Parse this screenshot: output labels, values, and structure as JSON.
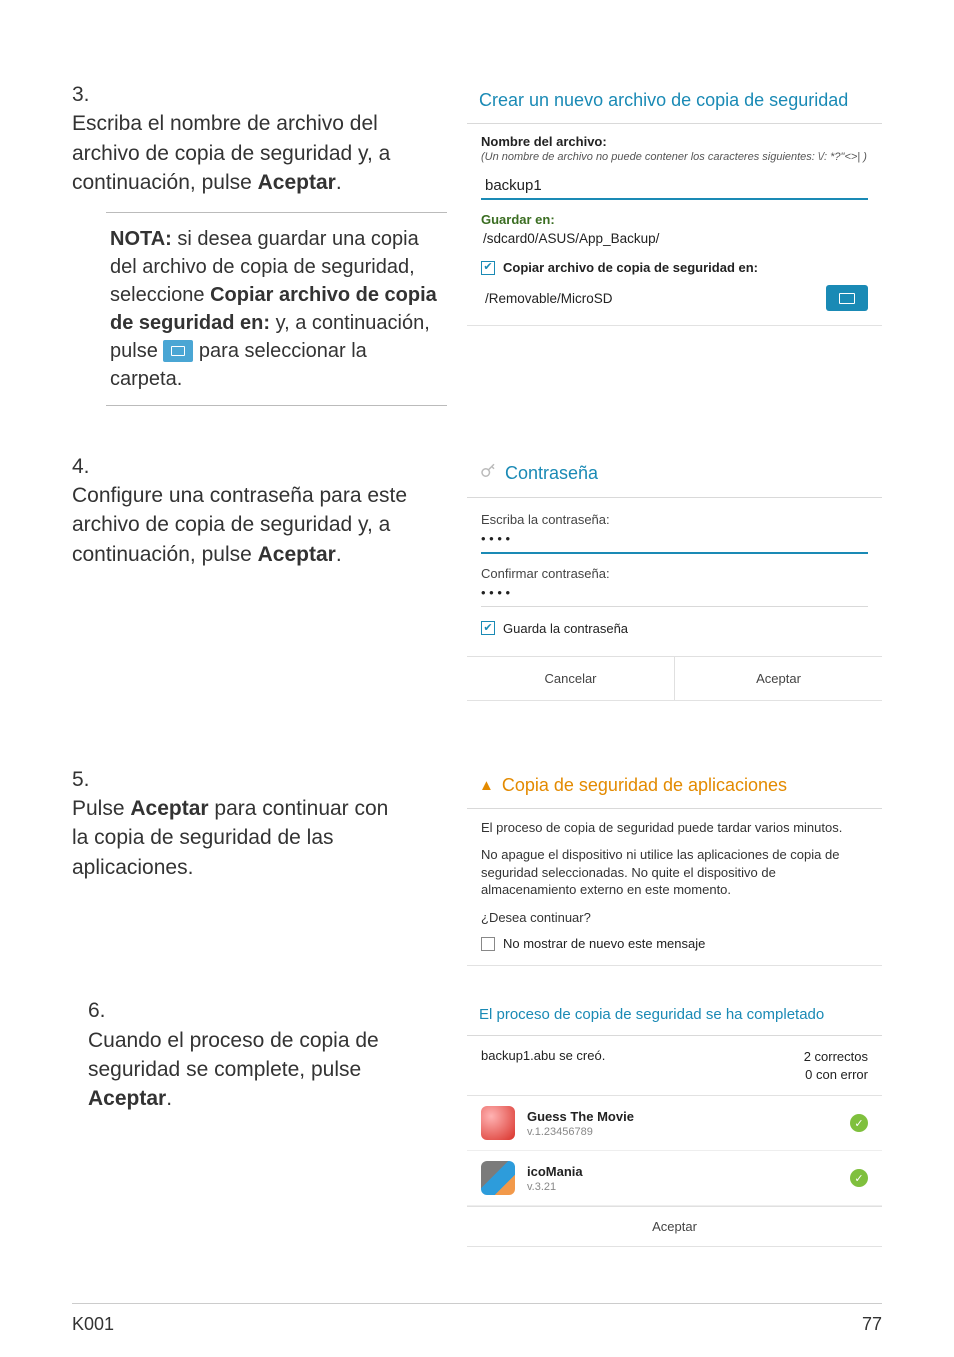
{
  "step3": {
    "num": "3.",
    "text1": "Escriba el nombre de archivo del archivo de copia de seguridad y, a continuación, pulse ",
    "accept": "Aceptar",
    "text2": "."
  },
  "note": {
    "label": "NOTA: ",
    "p1": "si desea guardar una copia del archivo de copia de seguridad, seleccione ",
    "b1": "Copiar archivo de copia de seguridad en:",
    "p2": " y, a continuación, pulse ",
    "p3": " para seleccionar la carpeta."
  },
  "panel1": {
    "title": "Crear un nuevo archivo de copia de seguridad",
    "filenameLabel": "Nombre del archivo:",
    "hint": "(Un nombre de archivo no puede contener los caracteres siguientes: \\/: *?\"<>| )",
    "filenameValue": "backup1",
    "saveInLabel": "Guardar en:",
    "path": "/sdcard0/ASUS/App_Backup/",
    "copyCheckboxLabel": "Copiar archivo de copia de seguridad en:",
    "destPath": "/Removable/MicroSD"
  },
  "step4": {
    "num": "4.",
    "text1": "Configure una contraseña para este archivo de copia de seguridad y, a continuación, pulse ",
    "accept": "Aceptar",
    "text2": "."
  },
  "panel2": {
    "title": "Contraseña",
    "enterPw": "Escriba la contraseña:",
    "confirmPw": "Confirmar contraseña:",
    "savePw": "Guarda la contraseña",
    "cancel": "Cancelar",
    "accept": "Aceptar"
  },
  "step5": {
    "num": "5.",
    "text1": "Pulse ",
    "accept": "Aceptar",
    "text2": " para continuar con la copia de seguridad de las aplicaciones."
  },
  "panel3": {
    "title": "Copia de seguridad de aplicaciones",
    "msg1": "El proceso de copia de seguridad puede tardar varios minutos.",
    "msg2": "No apague el dispositivo ni utilice las aplicaciones de copia de seguridad seleccionadas. No quite el dispositivo de almacenamiento externo en este momento.",
    "msg3": "¿Desea continuar?",
    "dontShow": "No mostrar de nuevo este mensaje"
  },
  "step6": {
    "num": "6.",
    "text1": "Cuando el proceso de copia de seguridad se complete, pulse ",
    "accept": "Aceptar",
    "text2": "."
  },
  "panel4": {
    "title": "El proceso de copia de seguridad se ha completado",
    "created": "backup1.abu se creó.",
    "okCount": "2 correctos",
    "errCount": "0 con error",
    "app1Name": "Guess The Movie",
    "app1Ver": "v.1.23456789",
    "app2Name": "icoMania",
    "app2Ver": "v.3.21",
    "accept": "Aceptar"
  },
  "footer": {
    "left": "K001",
    "right": "77"
  }
}
